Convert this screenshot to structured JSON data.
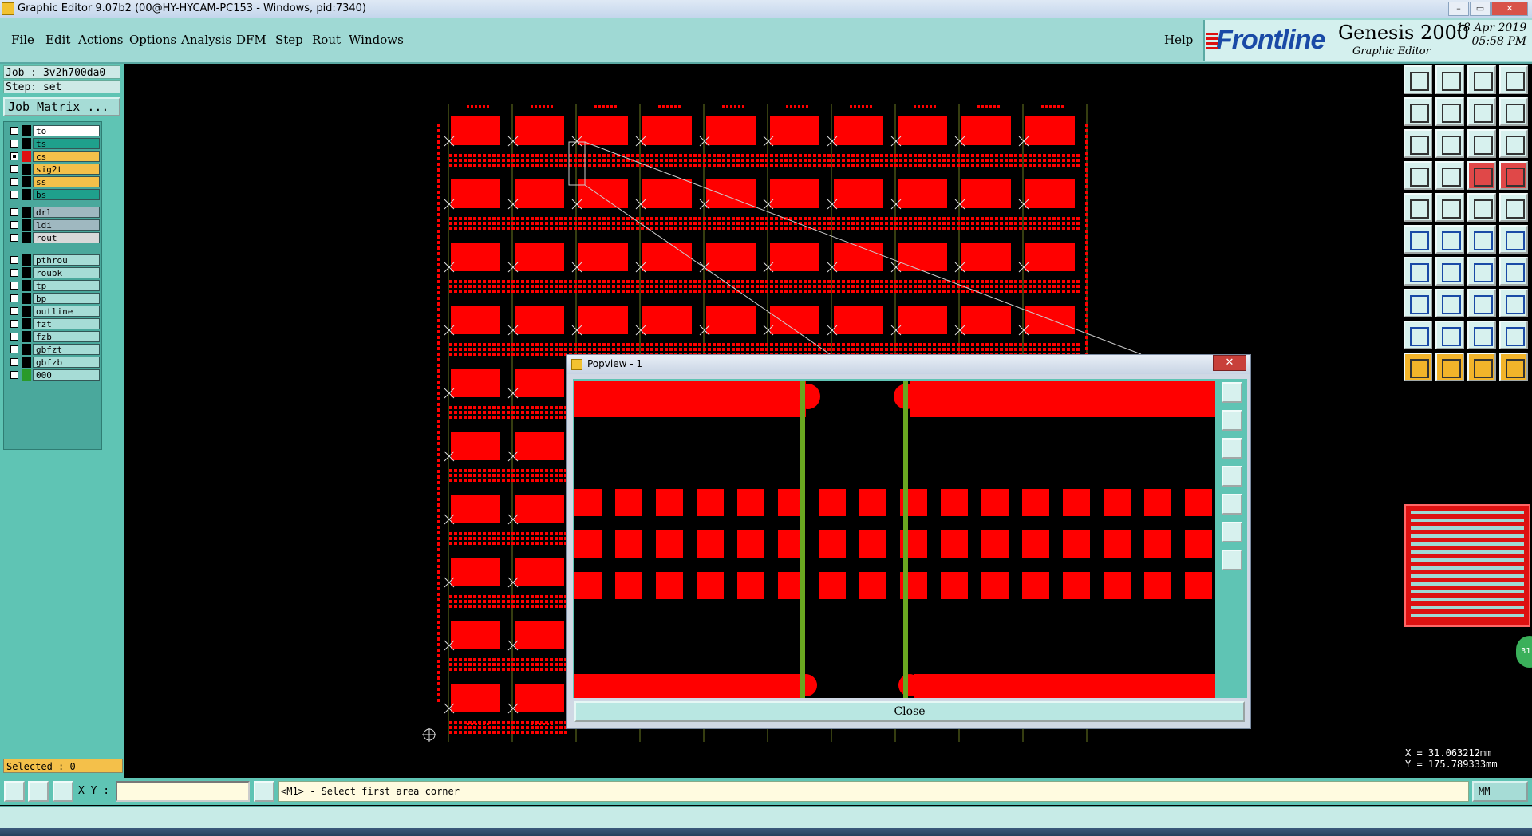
{
  "window": {
    "title": "Graphic Editor 9.07b2 (00@HY-HYCAM-PC153 - Windows, pid:7340)",
    "min_label": "–",
    "restore_label": "▭",
    "close_label": "✕"
  },
  "menubar": {
    "items": [
      "File",
      "Edit",
      "Actions",
      "Options",
      "Analysis",
      "DFM",
      "Step",
      "Rout",
      "Windows"
    ],
    "help": "Help",
    "brand": "Frontline",
    "product": "Genesis 2000",
    "subtitle": "Graphic Editor",
    "date": "18 Apr 2019",
    "time": "05:58 PM"
  },
  "left_panel": {
    "job": "Job : 3v2h700da0",
    "step": "Step: set",
    "job_matrix": "Job Matrix ...",
    "layers": [
      {
        "name": "to",
        "checked": false,
        "swatch": "#000000",
        "bg": "#ffffff"
      },
      {
        "name": "ts",
        "checked": false,
        "swatch": "#000000",
        "bg": "#1fa08c"
      },
      {
        "name": "cs",
        "checked": true,
        "swatch": "#e01010",
        "bg": "#f4c04a"
      },
      {
        "name": "sig2t",
        "checked": false,
        "swatch": "#000000",
        "bg": "#f4c04a"
      },
      {
        "name": "ss",
        "checked": false,
        "swatch": "#000000",
        "bg": "#f4c04a"
      },
      {
        "name": "bs",
        "checked": false,
        "swatch": "#000000",
        "bg": "#1fa08c"
      },
      {
        "name": "drl",
        "checked": false,
        "swatch": "#000000",
        "bg": "#9fb8c0"
      },
      {
        "name": "ldi",
        "checked": false,
        "swatch": "#000000",
        "bg": "#9fb8c0"
      },
      {
        "name": "rout",
        "checked": false,
        "swatch": "#000000",
        "bg": "#d8d8d8"
      },
      {
        "name": "pthrou",
        "checked": false,
        "swatch": "#000000",
        "bg": "#a6dcd6"
      },
      {
        "name": "roubk",
        "checked": false,
        "swatch": "#000000",
        "bg": "#a6dcd6"
      },
      {
        "name": "tp",
        "checked": false,
        "swatch": "#000000",
        "bg": "#a6dcd6"
      },
      {
        "name": "bp",
        "checked": false,
        "swatch": "#000000",
        "bg": "#a6dcd6"
      },
      {
        "name": "outline",
        "checked": false,
        "swatch": "#000000",
        "bg": "#a6dcd6"
      },
      {
        "name": "fzt",
        "checked": false,
        "swatch": "#000000",
        "bg": "#a6dcd6"
      },
      {
        "name": "fzb",
        "checked": false,
        "swatch": "#000000",
        "bg": "#a6dcd6"
      },
      {
        "name": "gbfzt",
        "checked": false,
        "swatch": "#000000",
        "bg": "#a6dcd6"
      },
      {
        "name": "gbfzb",
        "checked": false,
        "swatch": "#000000",
        "bg": "#a6dcd6"
      },
      {
        "name": "000",
        "checked": false,
        "swatch": "#2a9a2a",
        "bg": "#a6dcd6"
      }
    ],
    "selected": "Selected : 0"
  },
  "popview": {
    "title": "Popview - 1",
    "close_button": "Close"
  },
  "coords": {
    "x": "X = 31.063212mm",
    "y": "Y = 175.789333mm"
  },
  "command_bar": {
    "xy_label": "X Y :",
    "xy_value": "",
    "prompt": "<M1> - Select first area corner",
    "units": "MM"
  },
  "minimap_badge": "31",
  "colors": {
    "pad": "#ff0000",
    "panel": "#5fc4b4",
    "menubar": "#9fd9d4",
    "trace": "#6aa820"
  },
  "right_tools": [
    "zoom-home-icon",
    "zoom-back-icon",
    "home-icon",
    "layout-icon",
    "pan-left-icon",
    "pan-right-icon",
    "fit-icon",
    "split-icon",
    "zoom-fit-icon",
    "center-icon",
    "scale-1-2-icon",
    "help-icon",
    "snap-icon",
    "measure-line-icon",
    "layers-icon",
    "layers-alt-icon",
    "feature-select-icon",
    "highlight-icon",
    "ruler-icon",
    "pad-icon",
    "node-icon",
    "cross-icon",
    "connect-icon",
    "disconnect-icon",
    "line-icon",
    "slash-icon",
    "arc-icon",
    "flip-icon",
    "copy-pad-icon",
    "minus-icon",
    "resize-icon",
    "pad-group-icon",
    "triangle-icon",
    "letter-a-icon",
    "letter-a-box-icon",
    "letter-a-red-icon",
    "pointer-icon",
    "pointer-red-icon",
    "pointer-alt-icon",
    "pointer-move-icon"
  ]
}
